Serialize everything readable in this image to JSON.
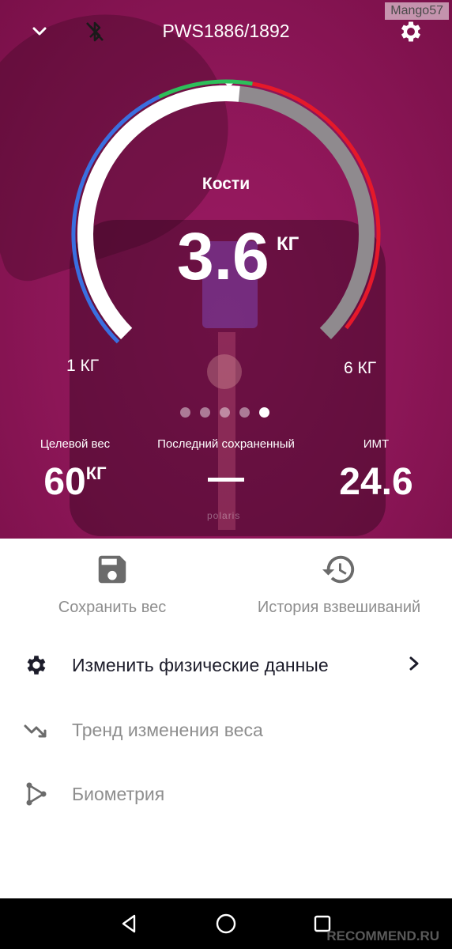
{
  "watermark": "Mango57",
  "header": {
    "title": "PWS1886/1892",
    "collapse_icon": "chevron-down-icon",
    "bluetooth_icon": "bluetooth-off-icon",
    "settings_icon": "gear-icon"
  },
  "gauge": {
    "label": "Кости",
    "value": "3.6",
    "unit": "КГ",
    "min_label": "1 КГ",
    "max_label": "6 КГ",
    "value_numeric": 3.6,
    "min": 1,
    "max": 6,
    "colors": {
      "low": "#3a6fe0",
      "normal": "#2dbf5a",
      "high": "#e5192a",
      "fill": "#ffffff",
      "track": "#8f8a8e"
    }
  },
  "pager": {
    "count": 5,
    "active_index": 4
  },
  "stats": {
    "target": {
      "label": "Целевой вес",
      "value": "60",
      "unit": "КГ"
    },
    "last_saved": {
      "label": "Последний сохраненный",
      "value": "—"
    },
    "bmi": {
      "label": "ИМТ",
      "value": "24.6"
    }
  },
  "actions": {
    "save": {
      "label": "Сохранить вес",
      "icon": "save-icon"
    },
    "history": {
      "label": "История взвешиваний",
      "icon": "history-icon"
    }
  },
  "menu": [
    {
      "label": "Изменить физические данные",
      "icon": "gear-icon",
      "enabled": true
    },
    {
      "label": "Тренд изменения веса",
      "icon": "trend-down-icon",
      "enabled": false
    },
    {
      "label": "Биометрия",
      "icon": "biometry-icon",
      "enabled": false
    }
  ],
  "scale_brand": "polaris",
  "footer_brand": "RECOMMEND.RU",
  "colors": {
    "accent": "#8c1657",
    "text_dark": "#1c1c2a",
    "text_muted": "#8e8e8e",
    "icon_muted": "#6b6b6b"
  }
}
